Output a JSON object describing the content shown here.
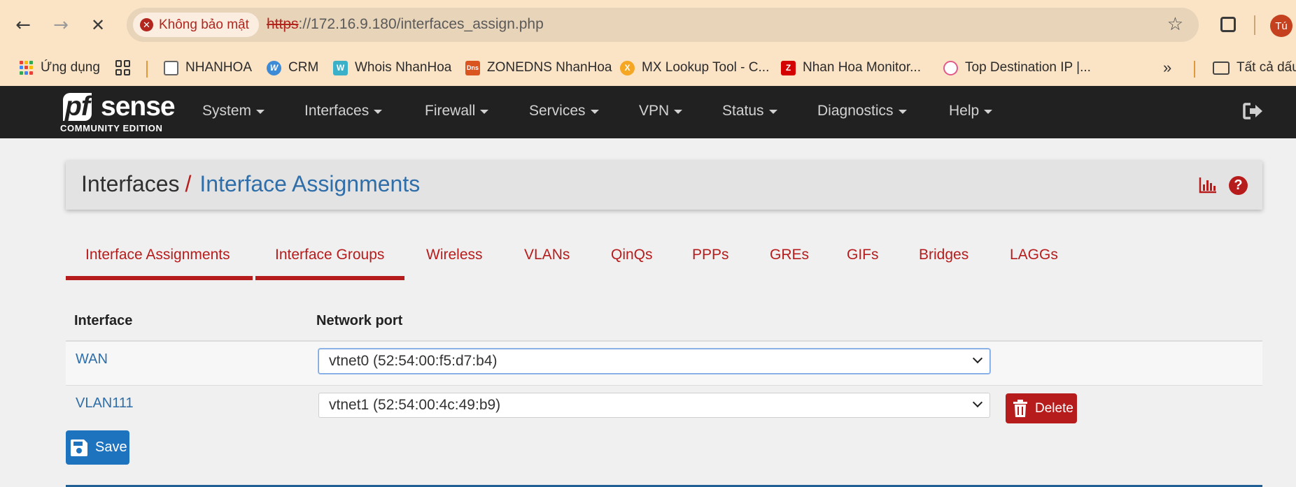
{
  "browser": {
    "security_label": "Không bảo mật",
    "url_scheme": "https",
    "url_rest": "://172.16.9.180/interfaces_assign.php",
    "profile_initial": "Tú",
    "bookmarks": [
      {
        "label": "Ứng dụng",
        "icon": "apps-grid-icon"
      },
      {
        "label": "",
        "icon": "tab-groups-icon"
      },
      {
        "label": "NHANHOA",
        "icon": "nhanhoa-icon"
      },
      {
        "label": "CRM",
        "icon": "crm-icon"
      },
      {
        "label": "Whois NhanHoa",
        "icon": "whois-icon"
      },
      {
        "label": "ZONEDNS NhanHoa",
        "icon": "dns-icon"
      },
      {
        "label": "MX Lookup Tool - C...",
        "icon": "mxtoolbox-icon"
      },
      {
        "label": "Nhan Hoa Monitor...",
        "icon": "zabbix-icon"
      },
      {
        "label": "Top Destination IP |...",
        "icon": "gauge-icon"
      }
    ],
    "all_bookmarks_label": "Tất cả dấu"
  },
  "navbar": {
    "logo_pf": "pf",
    "logo_sense": "sense",
    "logo_edition": "COMMUNITY EDITION",
    "menu": [
      "System",
      "Interfaces",
      "Firewall",
      "Services",
      "VPN",
      "Status",
      "Diagnostics",
      "Help"
    ]
  },
  "header": {
    "section": "Interfaces",
    "separator": "/",
    "page": "Interface Assignments"
  },
  "tabs": [
    "Interface Assignments",
    "Interface Groups",
    "Wireless",
    "VLANs",
    "QinQs",
    "PPPs",
    "GREs",
    "GIFs",
    "Bridges",
    "LAGGs"
  ],
  "table": {
    "headers": {
      "interface": "Interface",
      "network_port": "Network port"
    },
    "rows": [
      {
        "interface": "WAN",
        "port": "vtnet0 (52:54:00:f5:d7:b4)"
      },
      {
        "interface": "VLAN111",
        "port": "vtnet1 (52:54:00:4c:49:b9)"
      }
    ]
  },
  "buttons": {
    "delete": "Delete",
    "save": "Save"
  },
  "colors": {
    "accent_red": "#b71c1c",
    "link_blue": "#2f6ea8",
    "save_blue": "#1e73be",
    "navbar_dark": "#212121"
  }
}
